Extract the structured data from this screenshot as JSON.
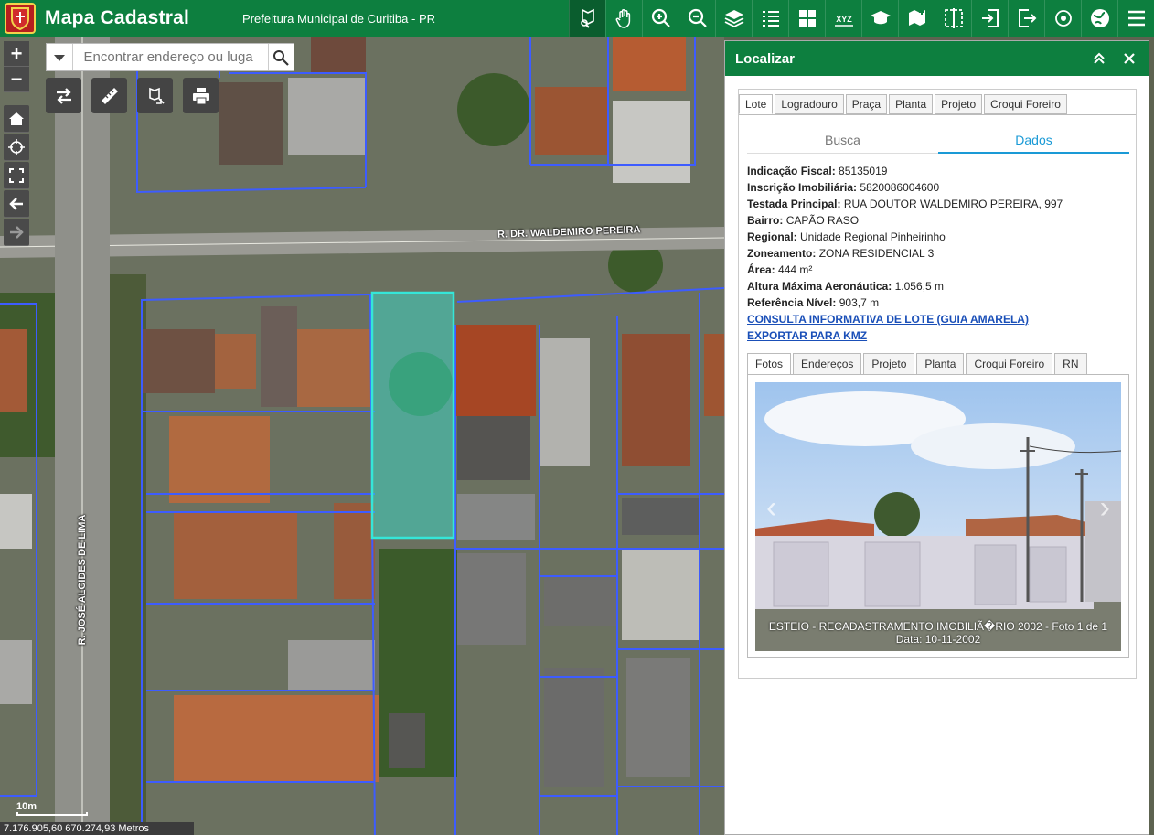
{
  "header": {
    "title": "Mapa Cadastral",
    "subtitle": "Prefeitura Municipal de Curitiba - PR",
    "tools": [
      {
        "icon": "identify-icon",
        "active": true
      },
      {
        "icon": "pan-hand-icon",
        "active": false
      },
      {
        "icon": "zoom-in-icon",
        "active": false
      },
      {
        "icon": "zoom-out-icon",
        "active": false
      },
      {
        "icon": "layers-icon",
        "active": false
      },
      {
        "icon": "legend-list-icon",
        "active": false
      },
      {
        "icon": "basemap-grid-icon",
        "active": false
      },
      {
        "icon": "xyz-coordinates-icon",
        "active": false
      },
      {
        "icon": "education-cap-icon",
        "active": false
      },
      {
        "icon": "add-data-icon",
        "active": false
      },
      {
        "icon": "swipe-compare-icon",
        "active": false
      },
      {
        "icon": "sign-in-icon",
        "active": false
      },
      {
        "icon": "sign-out-icon",
        "active": false
      },
      {
        "icon": "location-target-icon",
        "active": false
      },
      {
        "icon": "map-globe-icon",
        "active": false
      },
      {
        "icon": "menu-icon",
        "active": false
      }
    ],
    "tool_labels": {
      "xyz": "XYZ"
    }
  },
  "map": {
    "search": {
      "placeholder": "Encontrar endereço ou luga"
    },
    "street_horizontal": "R. DR. WALDEMIRO PEREIRA",
    "street_vertical": "R. JOSÉ ALCIDES DE LIMA",
    "scale_label": "10m",
    "coordinates": "7.176.905,60 670.274,93 Metros"
  },
  "panel": {
    "title": "Localizar",
    "tabs": [
      "Lote",
      "Logradouro",
      "Praça",
      "Planta",
      "Projeto",
      "Croqui Foreiro"
    ],
    "active_tab": "Lote",
    "subtabs": [
      "Busca",
      "Dados"
    ],
    "active_subtab": "Dados",
    "fields": [
      {
        "label": "Indicação Fiscal:",
        "value": "85135019"
      },
      {
        "label": "Inscrição Imobiliária:",
        "value": "5820086004600"
      },
      {
        "label": "Testada Principal:",
        "value": "RUA DOUTOR WALDEMIRO PEREIRA, 997"
      },
      {
        "label": "Bairro:",
        "value": "CAPÃO RASO"
      },
      {
        "label": "Regional:",
        "value": "Unidade Regional Pinheirinho"
      },
      {
        "label": "Zoneamento:",
        "value": "ZONA RESIDENCIAL 3"
      },
      {
        "label": "Área:",
        "value": "444 m²"
      },
      {
        "label": "Altura Máxima Aeronáutica:",
        "value": "1.056,5 m"
      },
      {
        "label": "Referência Nível:",
        "value": "903,7 m"
      }
    ],
    "links": [
      "CONSULTA INFORMATIVA DE LOTE (GUIA AMARELA)",
      "EXPORTAR PARA KMZ"
    ],
    "photo_tabs": [
      "Fotos",
      "Endereços",
      "Projeto",
      "Planta",
      "Croqui Foreiro",
      "RN"
    ],
    "photo_caption_1": "ESTEIO - RECADASTRAMENTO IMOBILIÃ�RIO 2002 - Foto 1 de 1",
    "photo_caption_2": "Data: 10-11-2002"
  },
  "colors": {
    "brand_green": "#0d7f3f",
    "link_blue": "#1a4fb8",
    "accent_blue": "#1a9ad6",
    "parcel_line": "#3d5cff",
    "selected_parcel": "#35e6d8"
  }
}
